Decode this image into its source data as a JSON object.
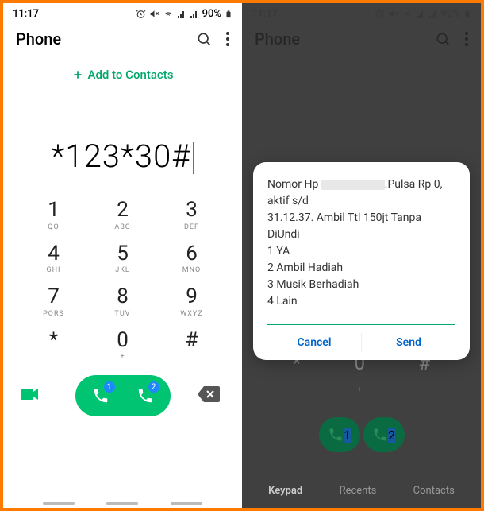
{
  "status": {
    "time": "11:17",
    "battery": "90%"
  },
  "left": {
    "title": "Phone",
    "add_contact": "Add to Contacts",
    "dialed": "*123*30#",
    "keys": [
      {
        "n": "1",
        "s": "QO"
      },
      {
        "n": "2",
        "s": "ABC"
      },
      {
        "n": "3",
        "s": "DEF"
      },
      {
        "n": "4",
        "s": "GHI"
      },
      {
        "n": "5",
        "s": "JKL"
      },
      {
        "n": "6",
        "s": "MNO"
      },
      {
        "n": "7",
        "s": "PQRS"
      },
      {
        "n": "8",
        "s": "TUV"
      },
      {
        "n": "9",
        "s": "WXYZ"
      },
      {
        "n": "*",
        "s": ""
      },
      {
        "n": "0",
        "s": "+"
      },
      {
        "n": "#",
        "s": ""
      }
    ],
    "sim_badges": [
      "1",
      "2"
    ]
  },
  "right": {
    "title": "Phone",
    "dialog": {
      "line1a": "Nomor Hp ",
      "line1b": ".Pulsa Rp 0, aktif s/d",
      "line2": "31.12.37. Ambil Ttl 150jt Tanpa DiUndi",
      "opt1": "1 YA",
      "opt2": "2 Ambil Hadiah",
      "opt3": "3 Musik Berhadiah",
      "opt4": "4 Lain",
      "cancel": "Cancel",
      "send": "Send"
    },
    "tabs": {
      "keypad": "Keypad",
      "recents": "Recents",
      "contacts": "Contacts"
    },
    "bg_zero": "0",
    "bg_plus": "+",
    "bg_star": "*",
    "bg_hash": "#"
  }
}
